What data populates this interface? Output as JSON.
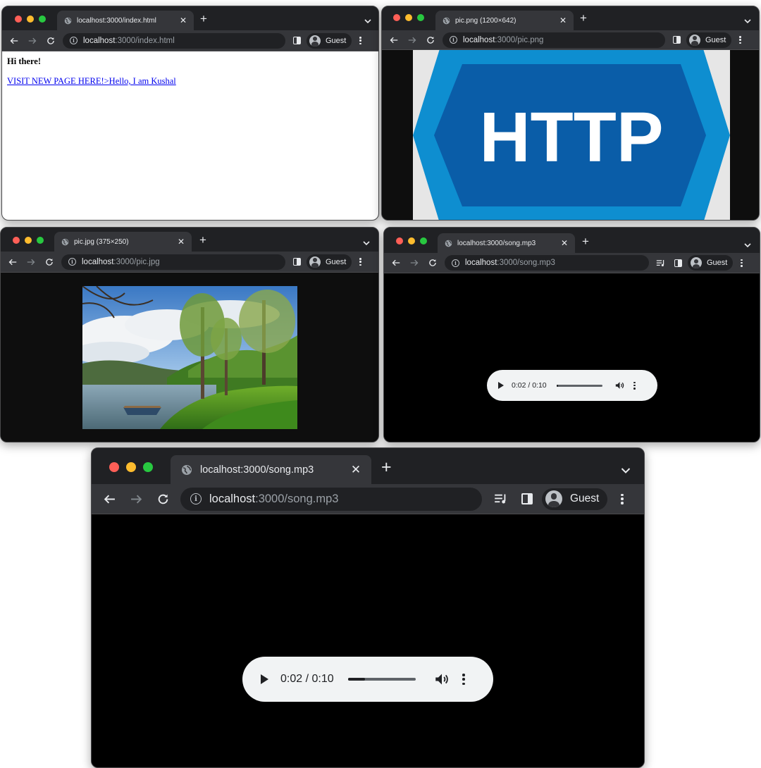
{
  "windows": {
    "index": {
      "tab_title": "localhost:3000/index.html",
      "url_host": "localhost",
      "url_path": ":3000/index.html",
      "profile": "Guest",
      "heading": "Hi there!",
      "link_text": "VISIT NEW PAGE HERE!>Hello, I am Kushal"
    },
    "png": {
      "tab_title": "pic.png (1200×642)",
      "url_host": "localhost",
      "url_path": ":3000/pic.png",
      "profile": "Guest",
      "logo_text": "HTTP"
    },
    "jpg": {
      "tab_title": "pic.jpg (375×250)",
      "url_host": "localhost",
      "url_path": ":3000/pic.jpg",
      "profile": "Guest"
    },
    "song_small": {
      "tab_title": "localhost:3000/song.mp3",
      "url_host": "localhost",
      "url_path": ":3000/song.mp3",
      "profile": "Guest",
      "player_time": "0:02 / 0:10",
      "progress": 0.03
    },
    "song_large": {
      "tab_title": "localhost:3000/song.mp3",
      "url_host": "localhost",
      "url_path": ":3000/song.mp3",
      "profile": "Guest",
      "player_time": "0:02 / 0:10",
      "progress": 0.25
    }
  },
  "colors": {
    "browser_frame": "#202124",
    "toolbar": "#35363a",
    "page_black": "#000000",
    "media_bg": "#0e0e0e",
    "link": "#0000ee",
    "http_dark_blue": "#0a5da8",
    "http_light_blue": "#0e8ed0"
  },
  "icons": [
    "back-arrow-icon",
    "forward-arrow-icon",
    "reload-icon",
    "info-icon",
    "side-panel-icon",
    "profile-avatar-icon",
    "kebab-menu-icon",
    "globe-icon",
    "close-icon",
    "new-tab-icon",
    "chevron-down-icon",
    "media-queue-icon",
    "play-icon",
    "volume-icon"
  ]
}
